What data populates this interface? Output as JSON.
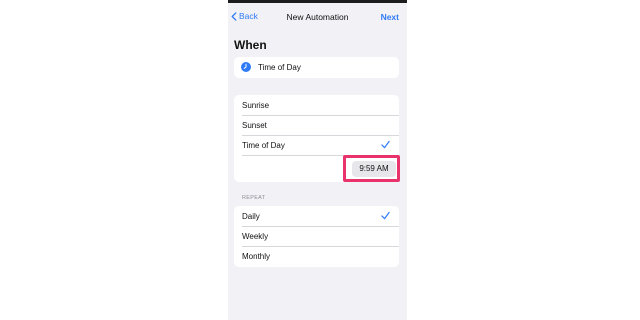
{
  "nav": {
    "back_label": "Back",
    "title": "New Automation",
    "next_label": "Next"
  },
  "section_title": "When",
  "trigger": {
    "label": "Time of Day",
    "icon": "clock-icon"
  },
  "options": [
    {
      "label": "Sunrise",
      "selected": false
    },
    {
      "label": "Sunset",
      "selected": false
    },
    {
      "label": "Time of Day",
      "selected": true
    }
  ],
  "time_value": "9:59 AM",
  "repeat": {
    "header": "REPEAT",
    "items": [
      {
        "label": "Daily",
        "selected": true
      },
      {
        "label": "Weekly",
        "selected": false
      },
      {
        "label": "Monthly",
        "selected": false
      }
    ]
  },
  "colors": {
    "accent": "#2f7bf6",
    "background": "#f2f1f6",
    "highlight": "#e8336d"
  }
}
